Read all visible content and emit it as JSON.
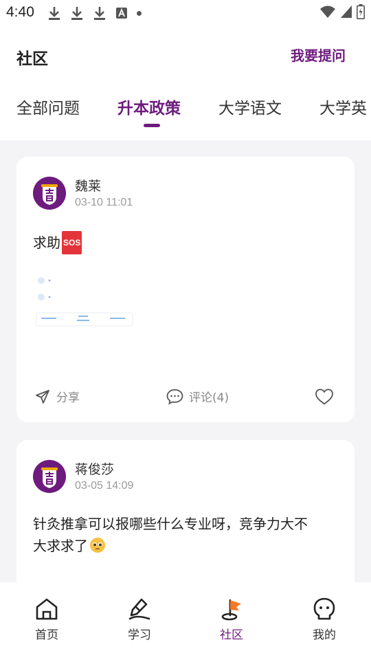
{
  "status_bar": {
    "time": "4:40",
    "icons": [
      "download-icon",
      "download-icon",
      "download-icon",
      "a-icon",
      "dot-icon",
      "wifi-icon",
      "signal-icon",
      "battery-icon"
    ]
  },
  "header": {
    "title": "社区",
    "ask_label": "我要提问"
  },
  "tabs": [
    {
      "label": "全部问题",
      "active": false
    },
    {
      "label": "升本政策",
      "active": true
    },
    {
      "label": "大学语文",
      "active": false
    },
    {
      "label": "大学英",
      "active": false
    }
  ],
  "posts": [
    {
      "author": "魏莱",
      "time": "03-10 11:01",
      "text": "求助",
      "badge": "SOS",
      "actions": {
        "share": "分享",
        "comment": "评论(4)"
      }
    },
    {
      "author": "蒋俊莎",
      "time": "03-05 14:09",
      "text_line1": "针灸推拿可以报哪些什么专业呀，竞争力大不",
      "text_line2": "大求求了"
    }
  ],
  "bottom_nav": [
    {
      "label": "首页",
      "icon": "home-icon",
      "active": false
    },
    {
      "label": "学习",
      "icon": "pen-icon",
      "active": false
    },
    {
      "label": "社区",
      "icon": "flag-icon",
      "active": true
    },
    {
      "label": "我的",
      "icon": "person-icon",
      "active": false
    }
  ],
  "colors": {
    "accent": "#6e1b7e",
    "background": "#f4f4f6",
    "muted_text": "#9a9a9a"
  }
}
